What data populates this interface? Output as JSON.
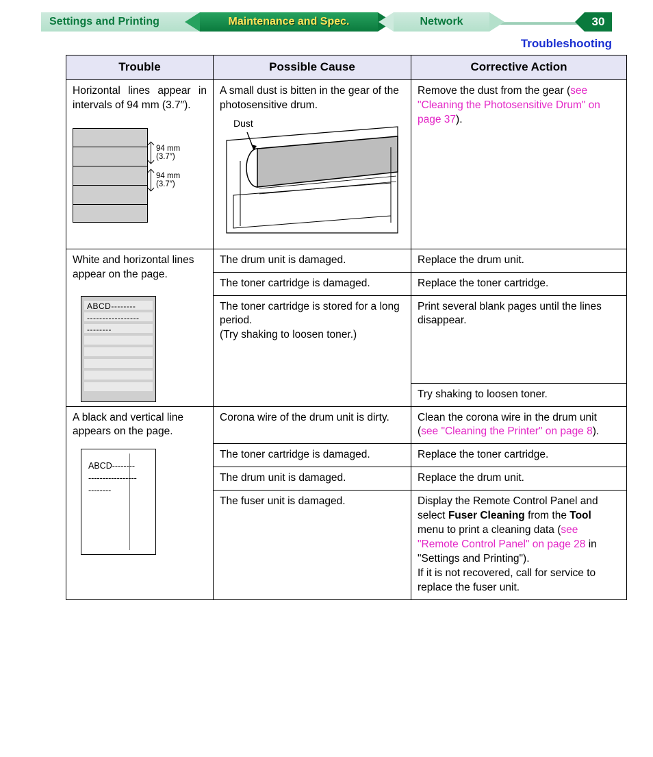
{
  "nav": {
    "settings": "Settings and Printing",
    "maint": "Maintenance and Spec.",
    "network": "Network",
    "pageno": "30"
  },
  "crumb": "Troubleshooting",
  "headers": {
    "c1": "Trouble",
    "c2": "Possible Cause",
    "c3": "Corrective Action"
  },
  "r1": {
    "trouble": "Horizontal lines appear in intervals of 94 mm (3.7″).",
    "dim1a": "94 mm",
    "dim1b": "(3.7″)",
    "dim2a": "94 mm",
    "dim2b": "(3.7″)",
    "cause": "A small dust is bitten in the gear of the photosensitive drum.",
    "dustLabel": "Dust",
    "fix_pre": "Remove the dust from the gear (",
    "fix_link": "see \"Cleaning the Photosensitive Drum\" on page 37",
    "fix_post": ")."
  },
  "r2": {
    "trouble": "White and horizontal lines appear on the page.",
    "sheet_l1": "ABCD--------",
    "sheet_l2": "-----------------",
    "sheet_l3": "--------",
    "a": {
      "cause": "The drum unit is damaged.",
      "fix": "Replace the drum unit."
    },
    "b": {
      "cause": "The toner cartridge is damaged.",
      "fix": "Replace the toner cartridge."
    },
    "c": {
      "cause_l1": "The toner cartridge is stored for a long period.",
      "cause_l2": "(Try shaking to loosen toner.)",
      "fix": "Print several blank pages until the lines disappear."
    },
    "d": {
      "fix": "Try shaking to loosen toner."
    }
  },
  "r3": {
    "trouble": "A black and vertical line appears on the page.",
    "sheet_l1": "ABCD--------",
    "sheet_l2": "-----------------",
    "sheet_l3": "--------",
    "a": {
      "cause": "Corona wire of the drum unit is dirty.",
      "fix_pre": "Clean the corona wire in the drum unit (",
      "fix_link": "see \"Cleaning the Printer\" on page 8",
      "fix_post": ")."
    },
    "b": {
      "cause": "The toner cartridge is damaged.",
      "fix": "Replace the toner cartridge."
    },
    "c": {
      "cause": "The drum unit is damaged.",
      "fix": "Replace the drum unit."
    },
    "d": {
      "cause": "The fuser unit is damaged.",
      "fix_p1_a": "Display the Remote Control Panel and select ",
      "fix_p1_bold": "Fuser Cleaning",
      "fix_p1_b": " from the ",
      "fix_p1_bold2": "Tool",
      "fix_p1_c": " menu to print a cleaning data (",
      "fix_link": "see \"Remote Control Panel\" on page 28",
      "fix_p1_d": " in \"Settings and Printing\").",
      "fix_p2": "If it is not recovered, call for service to replace the fuser unit."
    }
  }
}
